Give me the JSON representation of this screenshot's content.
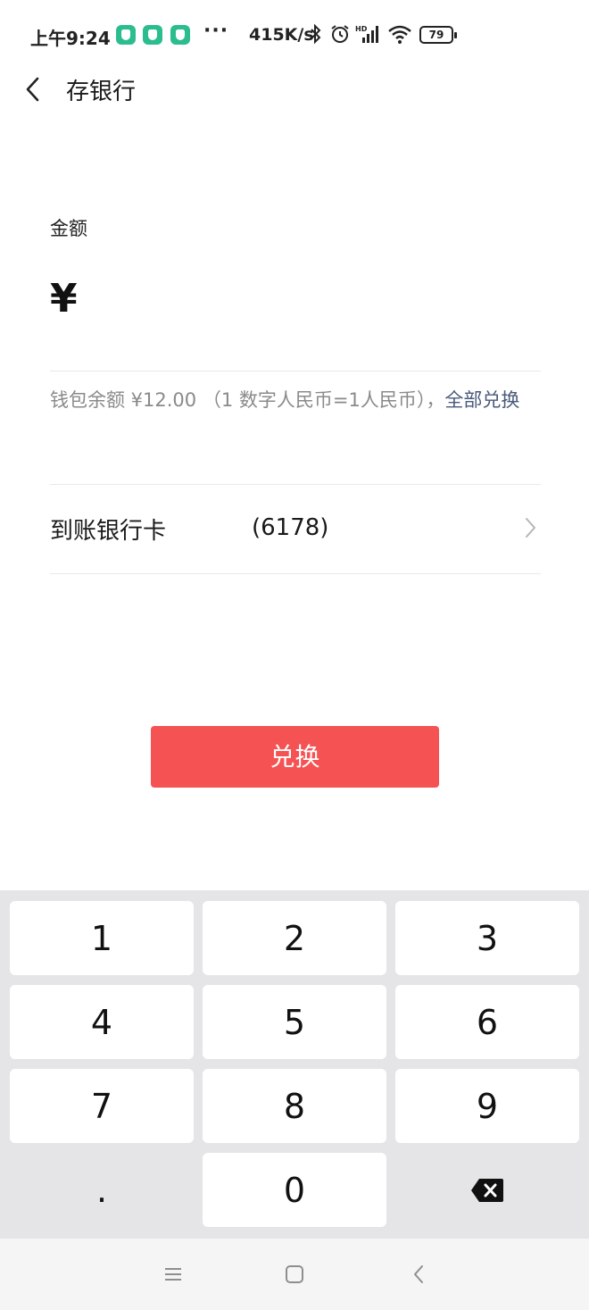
{
  "status_bar": {
    "time": "上午9:24",
    "dots": "···",
    "net_speed": "415K/s",
    "battery": "79",
    "app_icon_color": "#2bbd8e",
    "icons": [
      "shield-app-icon",
      "bluetooth-icon",
      "alarm-icon",
      "hd-signal-icon",
      "wifi-icon",
      "battery-icon"
    ]
  },
  "header": {
    "back_icon": "chevron-left-icon",
    "title": "存银行"
  },
  "amount": {
    "label": "金额",
    "currency_symbol": "¥",
    "value": ""
  },
  "balance": {
    "text": "钱包余额 ¥12.00 （1 数字人民币=1人民币），",
    "exchange_all": "全部兑换"
  },
  "bank": {
    "label": "到账银行卡",
    "card": "(6178)",
    "chevron_icon": "chevron-right-icon"
  },
  "confirm_button": {
    "label": "兑换",
    "color": "#f55353"
  },
  "keypad": {
    "keys": [
      "1",
      "2",
      "3",
      "4",
      "5",
      "6",
      "7",
      "8",
      "9",
      ".",
      "0"
    ],
    "delete_icon": "backspace-icon"
  },
  "nav_bar": {
    "icons": [
      "menu-icon",
      "home-square-icon",
      "back-triangle-icon"
    ]
  }
}
